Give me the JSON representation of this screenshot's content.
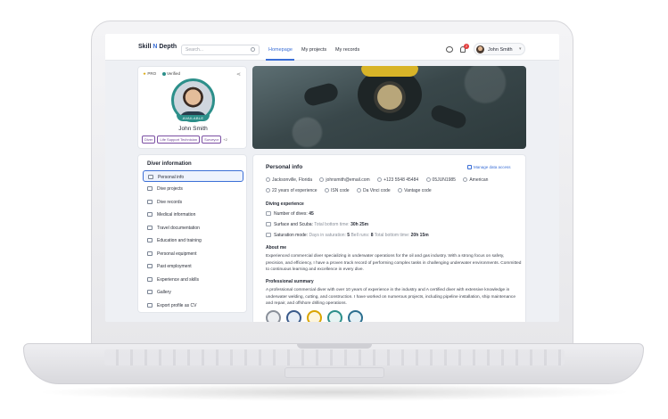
{
  "colors": {
    "accent": "#3b6fd6",
    "teal": "#2c8f8a",
    "tag": "#7b4fa3",
    "notify": "#e23b3b"
  },
  "app": {
    "logo_pre": "Skill ",
    "logo_n": "N",
    "logo_post": " Depth"
  },
  "search": {
    "placeholder": "Search..."
  },
  "nav": {
    "tabs": [
      {
        "label": "Homepage",
        "active": true
      },
      {
        "label": "My projects"
      },
      {
        "label": "My records"
      }
    ]
  },
  "notifications": {
    "count": "2"
  },
  "user": {
    "name": "John Smith"
  },
  "profile": {
    "pro_label": "PRO",
    "verified_label": "Verified",
    "status": "AVAILABLE",
    "name": "John Smith",
    "tags": [
      "Diver",
      "Life Support Technician",
      "Surveyor"
    ],
    "more": "+2"
  },
  "menu": {
    "title": "Diver information",
    "items": [
      {
        "label": "Personal info",
        "active": true
      },
      {
        "label": "Dive projects"
      },
      {
        "label": "Dive records"
      },
      {
        "label": "Medical information"
      },
      {
        "label": "Travel documentation"
      },
      {
        "label": "Education and training"
      },
      {
        "label": "Personal equipment"
      },
      {
        "label": "Past employment"
      },
      {
        "label": "Experience and skills"
      },
      {
        "label": "Gallery"
      },
      {
        "label": "Export profile as CV"
      }
    ]
  },
  "personal": {
    "title": "Personal info",
    "manage": "Manage data access",
    "location": "Jacksonville, Florida",
    "email": "johnsmith@email.com",
    "phone": "+123 5548 45484",
    "dob": "05JUN1985",
    "nationality": "American",
    "experience": "22 years of experience",
    "isn": "ISN code",
    "da_vinci": "Da Vinci code",
    "vantage": "Vantage code"
  },
  "diving": {
    "title": "Diving experience",
    "dives_label": "Number of dives:",
    "dives_value": "45",
    "surface_label": "Surface and Scuba:",
    "surface_bottom_label": "Total bottom time:",
    "surface_bottom_value": "30h 25m",
    "sat_label": "Saturation mode:",
    "sat_days_label": "Days in saturation:",
    "sat_days_value": "5",
    "bell_label": "Bell runs:",
    "bell_value": "8",
    "sat_bottom_label": "Total bottom time:",
    "sat_bottom_value": "20h 15m"
  },
  "about": {
    "title": "About me",
    "text": "Experienced commercial diver specializing in underwater operations for the oil and gas industry. With a strong focus on safety, precision, and efficiency, I have a proven track record of performing complex tasks in challenging underwater environments. Committed to continuous learning and excellence in every dive."
  },
  "summary": {
    "title": "Professional summary",
    "text": "A professional commercial diver with over 10 years of experience in the industry and A certified diver with extensive knowledge in underwater welding, cutting, and construction. I have worked on numerous projects, including pipeline installation, ship maintenance and repair, and offshore drilling operations."
  },
  "badges": [
    {
      "name": "badge-iso",
      "color": "#8a909a"
    },
    {
      "name": "badge-shield",
      "color": "#3a5a8a"
    },
    {
      "name": "badge-gold",
      "color": "#d9a400"
    },
    {
      "name": "badge-green",
      "color": "#2c8f8a"
    },
    {
      "name": "badge-blue",
      "color": "#2c6f8f"
    }
  ]
}
